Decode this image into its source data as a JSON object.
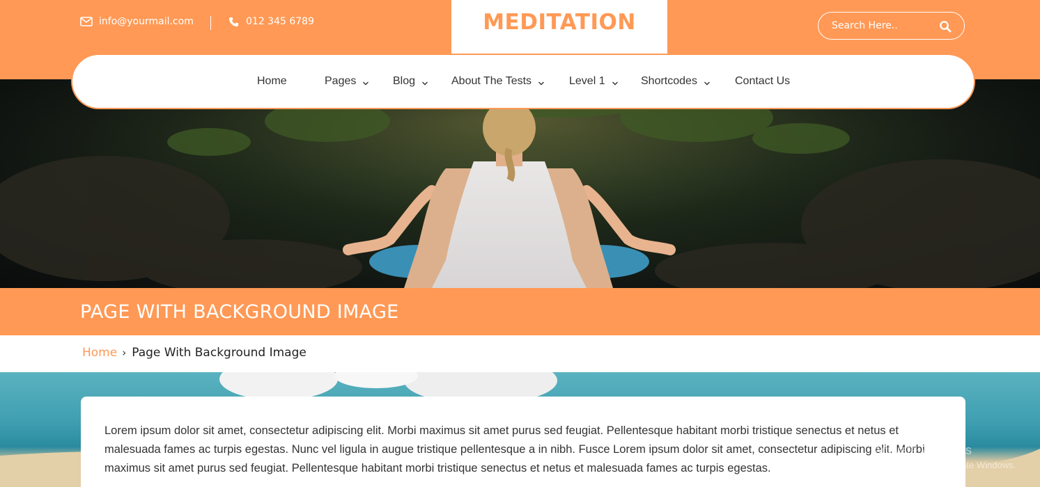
{
  "header": {
    "email": "info@yourmail.com",
    "phone": "012 345 6789",
    "logo": "MEDITATION",
    "search_placeholder": "Search Here.."
  },
  "nav": {
    "items": [
      {
        "label": "Home",
        "has_dropdown": false
      },
      {
        "label": "Pages",
        "has_dropdown": true
      },
      {
        "label": "Blog",
        "has_dropdown": true
      },
      {
        "label": "About The Tests",
        "has_dropdown": true
      },
      {
        "label": "Level 1",
        "has_dropdown": true
      },
      {
        "label": "Shortcodes",
        "has_dropdown": true
      },
      {
        "label": "Contact Us",
        "has_dropdown": false
      }
    ]
  },
  "page": {
    "title": "PAGE WITH BACKGROUND IMAGE"
  },
  "breadcrumb": {
    "home": "Home",
    "separator": "›",
    "current": "Page With Background Image"
  },
  "content": {
    "paragraph": "Lorem ipsum dolor sit amet, consectetur adipiscing elit. Morbi maximus sit amet purus sed feugiat. Pellentesque habitant morbi tristique senectus et netus et malesuada fames ac turpis egestas. Nunc vel ligula in augue tristique pellentesque a in nibh. Fusce Lorem ipsum dolor sit amet, consectetur adipiscing elit. Morbi maximus sit amet purus sed feugiat. Pellentesque habitant morbi tristique senectus et netus et malesuada fames ac turpis egestas."
  },
  "watermark": {
    "line1": "Activate Windows",
    "line2": "Go to Settings to activate Windows."
  },
  "colors": {
    "accent": "#ff9955",
    "text": "#333333",
    "white": "#ffffff"
  },
  "icons": {
    "email": "envelope-icon",
    "phone": "phone-icon",
    "search": "search-icon",
    "dropdown": "chevron-down-icon"
  }
}
